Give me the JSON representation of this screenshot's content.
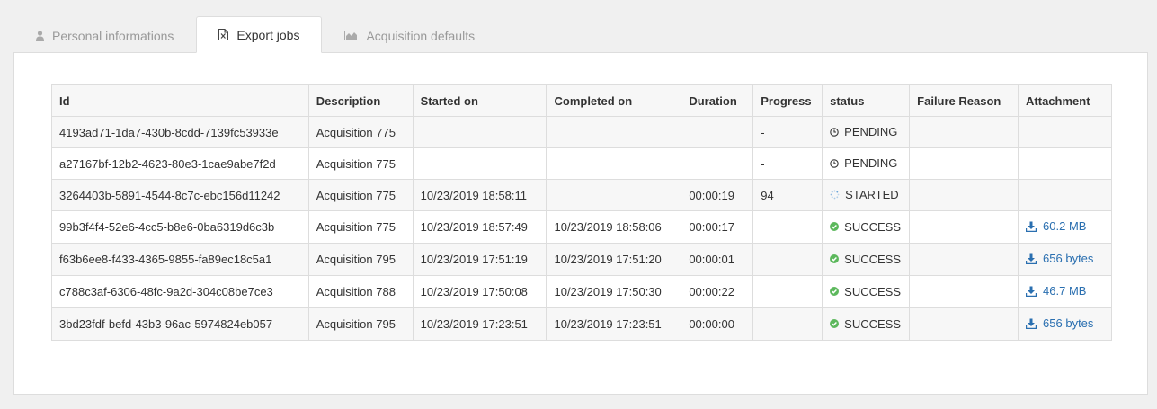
{
  "tabs": [
    {
      "label": "Personal informations",
      "icon": "user-icon",
      "active": false
    },
    {
      "label": "Export jobs",
      "icon": "excel-file-icon",
      "active": true
    },
    {
      "label": "Acquisition defaults",
      "icon": "area-chart-icon",
      "active": false
    }
  ],
  "table": {
    "headers": [
      "Id",
      "Description",
      "Started on",
      "Completed on",
      "Duration",
      "Progress",
      "status",
      "Failure Reason",
      "Attachment"
    ],
    "rows": [
      {
        "id": "4193ad71-1da7-430b-8cdd-7139fc53933e",
        "description": "Acquisition 775",
        "started": "",
        "completed": "",
        "duration": "",
        "progress": "-",
        "status": "PENDING",
        "status_icon": "clock-icon",
        "failure": "",
        "attachment": ""
      },
      {
        "id": "a27167bf-12b2-4623-80e3-1cae9abe7f2d",
        "description": "Acquisition 775",
        "started": "",
        "completed": "",
        "duration": "",
        "progress": "-",
        "status": "PENDING",
        "status_icon": "clock-icon",
        "failure": "",
        "attachment": ""
      },
      {
        "id": "3264403b-5891-4544-8c7c-ebc156d11242",
        "description": "Acquisition 775",
        "started": "10/23/2019 18:58:11",
        "completed": "",
        "duration": "00:00:19",
        "progress": "94",
        "status": "STARTED",
        "status_icon": "spinner-icon",
        "failure": "",
        "attachment": ""
      },
      {
        "id": "99b3f4f4-52e6-4cc5-b8e6-0ba6319d6c3b",
        "description": "Acquisition 775",
        "started": "10/23/2019 18:57:49",
        "completed": "10/23/2019 18:58:06",
        "duration": "00:00:17",
        "progress": "",
        "status": "SUCCESS",
        "status_icon": "check-circle-icon",
        "failure": "",
        "attachment": "60.2 MB"
      },
      {
        "id": "f63b6ee8-f433-4365-9855-fa89ec18c5a1",
        "description": "Acquisition 795",
        "started": "10/23/2019 17:51:19",
        "completed": "10/23/2019 17:51:20",
        "duration": "00:00:01",
        "progress": "",
        "status": "SUCCESS",
        "status_icon": "check-circle-icon",
        "failure": "",
        "attachment": "656 bytes"
      },
      {
        "id": "c788c3af-6306-48fc-9a2d-304c08be7ce3",
        "description": "Acquisition 788",
        "started": "10/23/2019 17:50:08",
        "completed": "10/23/2019 17:50:30",
        "duration": "00:00:22",
        "progress": "",
        "status": "SUCCESS",
        "status_icon": "check-circle-icon",
        "failure": "",
        "attachment": "46.7 MB"
      },
      {
        "id": "3bd23fdf-befd-43b3-96ac-5974824eb057",
        "description": "Acquisition 795",
        "started": "10/23/2019 17:23:51",
        "completed": "10/23/2019 17:23:51",
        "duration": "00:00:00",
        "progress": "",
        "status": "SUCCESS",
        "status_icon": "check-circle-icon",
        "failure": "",
        "attachment": "656 bytes"
      }
    ]
  },
  "colors": {
    "success": "#5cb85c",
    "link": "#2a6fb0",
    "spinner": "#5b9bd5",
    "muted": "#999999"
  }
}
